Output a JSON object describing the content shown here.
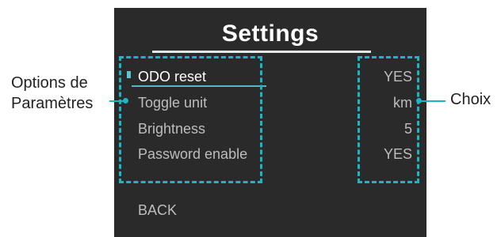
{
  "screen": {
    "title": "Settings",
    "options": [
      {
        "label": "ODO reset",
        "value": "YES",
        "selected": true
      },
      {
        "label": "Toggle unit",
        "value": "km",
        "selected": false
      },
      {
        "label": "Brightness",
        "value": "5",
        "selected": false
      },
      {
        "label": "Password enable",
        "value": "YES",
        "selected": false
      }
    ],
    "back_label": "BACK"
  },
  "annotations": {
    "left_line1": "Options de",
    "left_line2": "Paramètres",
    "right": "Choix"
  },
  "colors": {
    "screen_background": "#2a2a2a",
    "accent": "#1ab6c4",
    "text_selected": "#ffffff",
    "text_normal": "#bdbdbd"
  }
}
